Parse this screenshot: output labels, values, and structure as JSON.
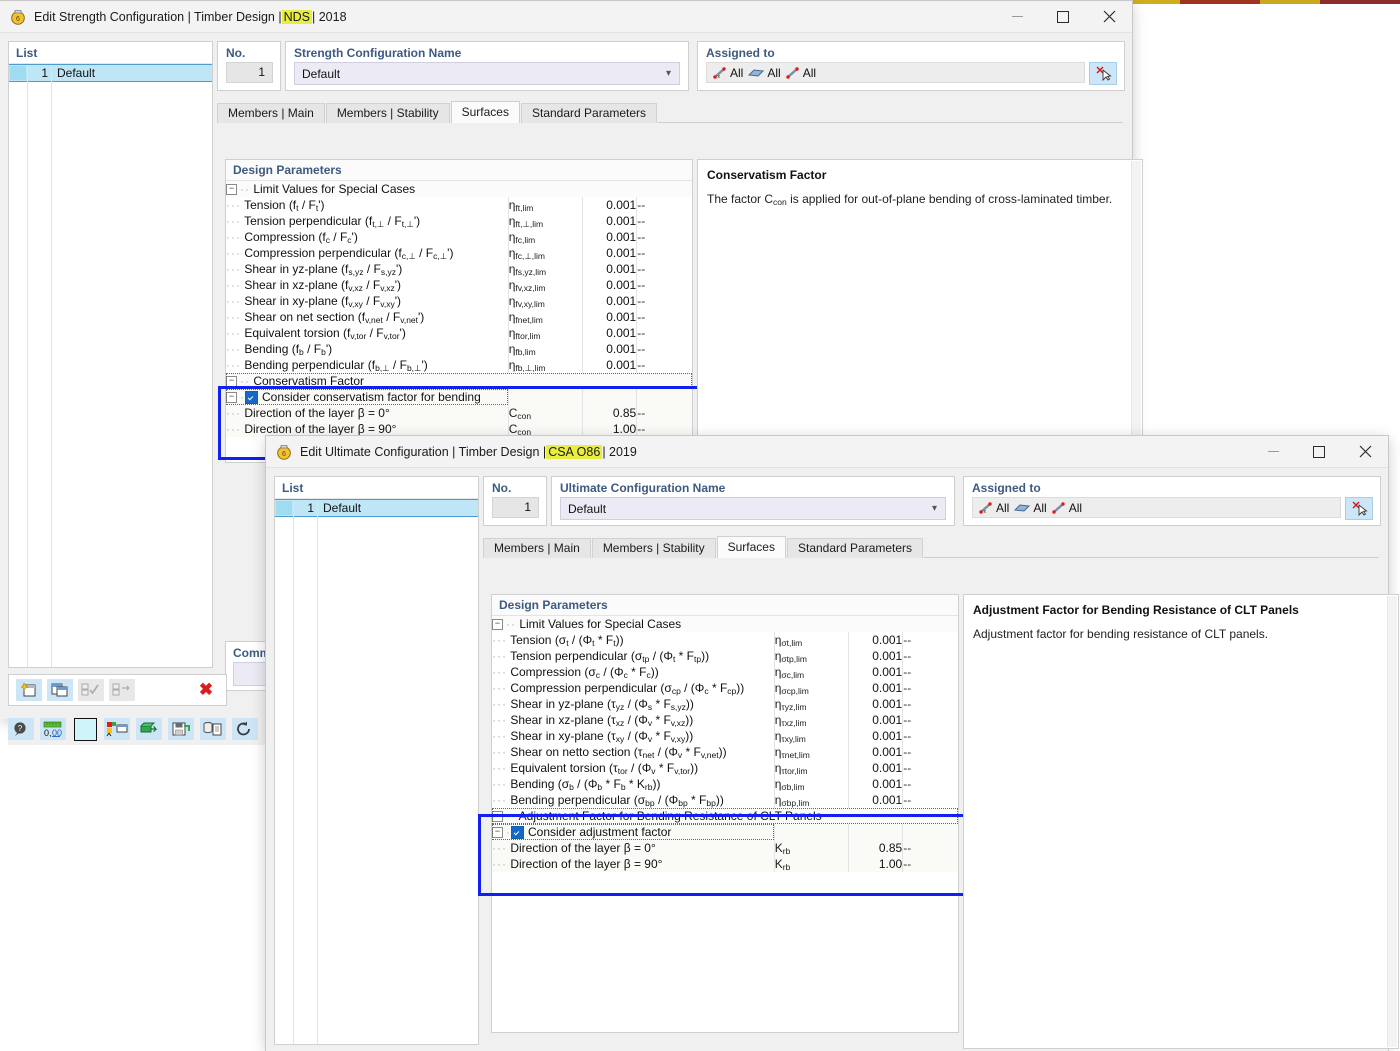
{
  "window1": {
    "title_prefix": "Edit Strength Configuration | Timber Design |",
    "title_code": "NDS",
    "title_suffix": "| 2018",
    "icon": "app-icon",
    "controls": {
      "minimize": "–",
      "maximize": "□",
      "close": "✕"
    },
    "list": {
      "header": "List",
      "rows": [
        {
          "num": "1",
          "label": "Default"
        }
      ]
    },
    "no": {
      "label": "No.",
      "value": "1"
    },
    "name": {
      "label": "Strength Configuration Name",
      "value": "Default",
      "caret": "chevron-down-icon"
    },
    "assigned": {
      "label": "Assigned to",
      "items": [
        {
          "icon": "member-icon",
          "text": "All"
        },
        {
          "icon": "surface-icon",
          "text": "All"
        },
        {
          "icon": "line-icon",
          "text": "All"
        }
      ],
      "button_icon": "deselect-icon"
    },
    "tabs": [
      {
        "label": "Members | Main",
        "active": false
      },
      {
        "label": "Members | Stability",
        "active": false
      },
      {
        "label": "Surfaces",
        "active": true
      },
      {
        "label": "Standard Parameters",
        "active": false
      }
    ],
    "grid": {
      "title": "Design Parameters",
      "group1": "Limit Values for Special Cases",
      "rows": [
        {
          "name": "Tension (f<sub>t</sub> / F<sub>t</sub>')",
          "sym": "η<sub>ft,lim</sub>",
          "val": "0.001",
          "unit": "--"
        },
        {
          "name": "Tension perpendicular (f<sub>t,⊥</sub> / F<sub>t,⊥</sub>')",
          "sym": "η<sub>ft,⊥,lim</sub>",
          "val": "0.001",
          "unit": "--"
        },
        {
          "name": "Compression (f<sub>c</sub> / F<sub>c</sub>')",
          "sym": "η<sub>fc,lim</sub>",
          "val": "0.001",
          "unit": "--"
        },
        {
          "name": "Compression perpendicular (f<sub>c,⊥</sub> / F<sub>c,⊥</sub>')",
          "sym": "η<sub>fc,⊥,lim</sub>",
          "val": "0.001",
          "unit": "--"
        },
        {
          "name": "Shear in yz-plane (f<sub>s,yz</sub> / F<sub>s,yz</sub>')",
          "sym": "η<sub>fs,yz,lim</sub>",
          "val": "0.001",
          "unit": "--"
        },
        {
          "name": "Shear in xz-plane (f<sub>v,xz</sub> / F<sub>v,xz</sub>')",
          "sym": "η<sub>fv,xz,lim</sub>",
          "val": "0.001",
          "unit": "--"
        },
        {
          "name": "Shear in xy-plane (f<sub>v,xy</sub> / F<sub>v,xy</sub>')",
          "sym": "η<sub>fv,xy,lim</sub>",
          "val": "0.001",
          "unit": "--"
        },
        {
          "name": "Shear on net section (f<sub>v,net</sub> / F<sub>v,net</sub>')",
          "sym": "η<sub>fnet,lim</sub>",
          "val": "0.001",
          "unit": "--"
        },
        {
          "name": "Equivalent torsion (f<sub>v,tor</sub> / F<sub>v,tor</sub>')",
          "sym": "η<sub>ftor,lim</sub>",
          "val": "0.001",
          "unit": "--"
        },
        {
          "name": "Bending (f<sub>b</sub> / F<sub>b</sub>')",
          "sym": "η<sub>fb,lim</sub>",
          "val": "0.001",
          "unit": "--"
        },
        {
          "name": "Bending perpendicular (f<sub>b,⊥</sub> / F<sub>b,⊥</sub>')",
          "sym": "η<sub>fb,⊥,lim</sub>",
          "val": "0.001",
          "unit": "--"
        }
      ],
      "group2": "Conservatism Factor",
      "checkbox_row": "Consider conservatism factor for bending",
      "checkbox_checked": true,
      "factor_rows": [
        {
          "name": "Direction of the layer β = 0°",
          "sym": "C<sub>con</sub>",
          "val": "0.85",
          "unit": "--"
        },
        {
          "name": "Direction of the layer β = 90°",
          "sym": "C<sub>con</sub>",
          "val": "1.00",
          "unit": "--"
        }
      ]
    },
    "info": {
      "heading": "Conservatism Factor",
      "text": "The factor Cᴄᴏɴ is applied for out-of-plane bending of cross-laminated timber.",
      "text_pre": "The factor C",
      "text_sub": "con",
      "text_post": " is applied for out-of-plane bending of cross-laminated timber."
    },
    "comment": {
      "label": "Comm"
    },
    "toolbar_top": [
      {
        "icon": "new-item-icon",
        "state": "enabled"
      },
      {
        "icon": "copy-item-icon",
        "state": "enabled"
      },
      {
        "icon": "select-all-icon",
        "state": "disabled"
      },
      {
        "icon": "deselect-all-icon",
        "state": "disabled"
      },
      {
        "icon": "delete-red-x-icon",
        "state": "enabled"
      }
    ],
    "toolbar_bottom": [
      {
        "icon": "help-icon"
      },
      {
        "icon": "units-icon"
      },
      {
        "icon": "color-swatch-icon"
      },
      {
        "icon": "display-properties-icon"
      },
      {
        "icon": "import-icon"
      },
      {
        "icon": "save-icon"
      },
      {
        "icon": "database-report-icon"
      },
      {
        "icon": "reset-icon"
      }
    ]
  },
  "window2": {
    "title_prefix": "Edit Ultimate Configuration | Timber Design |",
    "title_code": "CSA O86",
    "title_suffix": "| 2019",
    "icon": "app-icon",
    "controls": {
      "minimize": "–",
      "maximize": "□",
      "close": "✕"
    },
    "list": {
      "header": "List",
      "rows": [
        {
          "num": "1",
          "label": "Default"
        }
      ]
    },
    "no": {
      "label": "No.",
      "value": "1"
    },
    "name": {
      "label": "Ultimate Configuration Name",
      "value": "Default",
      "caret": "chevron-down-icon"
    },
    "assigned": {
      "label": "Assigned to",
      "items": [
        {
          "icon": "member-icon",
          "text": "All"
        },
        {
          "icon": "surface-icon",
          "text": "All"
        },
        {
          "icon": "line-icon",
          "text": "All"
        }
      ],
      "button_icon": "deselect-icon"
    },
    "tabs": [
      {
        "label": "Members | Main",
        "active": false
      },
      {
        "label": "Members | Stability",
        "active": false
      },
      {
        "label": "Surfaces",
        "active": true
      },
      {
        "label": "Standard Parameters",
        "active": false
      }
    ],
    "grid": {
      "title": "Design Parameters",
      "group1": "Limit Values for Special Cases",
      "rows": [
        {
          "name": "Tension (σ<sub>t</sub> / (Φ<sub>t</sub> * F<sub>t</sub>))",
          "sym": "η<sub>σt,lim</sub>",
          "val": "0.001",
          "unit": "--"
        },
        {
          "name": "Tension perpendicular (σ<sub>tp</sub> / (Φ<sub>t</sub> * F<sub>tp</sub>))",
          "sym": "η<sub>σtp,lim</sub>",
          "val": "0.001",
          "unit": "--"
        },
        {
          "name": "Compression (σ<sub>c</sub> / (Φ<sub>c</sub> * F<sub>c</sub>))",
          "sym": "η<sub>σc,lim</sub>",
          "val": "0.001",
          "unit": "--"
        },
        {
          "name": "Compression perpendicular (σ<sub>cp</sub> / (Φ<sub>c</sub> * F<sub>cp</sub>))",
          "sym": "η<sub>σcp,lim</sub>",
          "val": "0.001",
          "unit": "--"
        },
        {
          "name": "Shear in yz-plane (τ<sub>yz</sub> / (Φ<sub>s</sub> * F<sub>s,yz</sub>))",
          "sym": "η<sub>τyz,lim</sub>",
          "val": "0.001",
          "unit": "--"
        },
        {
          "name": "Shear in xz-plane (τ<sub>xz</sub> / (Φ<sub>v</sub> * F<sub>v,xz</sub>))",
          "sym": "η<sub>τxz,lim</sub>",
          "val": "0.001",
          "unit": "--"
        },
        {
          "name": "Shear in xy-plane (τ<sub>xy</sub> / (Φ<sub>v</sub> * F<sub>v,xy</sub>))",
          "sym": "η<sub>τxy,lim</sub>",
          "val": "0.001",
          "unit": "--"
        },
        {
          "name": "Shear on netto section (τ<sub>net</sub> / (Φ<sub>v</sub> * F<sub>v,net</sub>))",
          "sym": "η<sub>τnet,lim</sub>",
          "val": "0.001",
          "unit": "--"
        },
        {
          "name": "Equivalent torsion (τ<sub>tor</sub> / (Φ<sub>v</sub> * F<sub>v,tor</sub>))",
          "sym": "η<sub>τtor,lim</sub>",
          "val": "0.001",
          "unit": "--"
        },
        {
          "name": "Bending (σ<sub>b</sub> / (Φ<sub>b</sub> * F<sub>b</sub> * K<sub>rb</sub>))",
          "sym": "η<sub>σb,lim</sub>",
          "val": "0.001",
          "unit": "--"
        },
        {
          "name": "Bending perpendicular (σ<sub>bp</sub> / (Φ<sub>bp</sub> * F<sub>bp</sub>))",
          "sym": "η<sub>σbp,lim</sub>",
          "val": "0.001",
          "unit": "--"
        }
      ],
      "group2": "Adjustment Factor for Bending Resistance of CLT Panels",
      "checkbox_row": "Consider adjustment factor",
      "checkbox_checked": true,
      "factor_rows": [
        {
          "name": "Direction of the layer β = 0°",
          "sym": "K<sub>rb</sub>",
          "val": "0.85",
          "unit": "--"
        },
        {
          "name": "Direction of the layer β = 90°",
          "sym": "K<sub>rb</sub>",
          "val": "1.00",
          "unit": "--"
        }
      ]
    },
    "info": {
      "heading": "Adjustment Factor for Bending Resistance of CLT Panels",
      "text": "Adjustment factor for bending resistance of CLT panels."
    }
  },
  "colors": {
    "highlight_yellow": "#e8ed40",
    "callout_blue": "#1020f0",
    "header_blue": "#3d5a80",
    "selection_cyan": "#bfe6f7",
    "delete_red": "#e01b1b"
  }
}
